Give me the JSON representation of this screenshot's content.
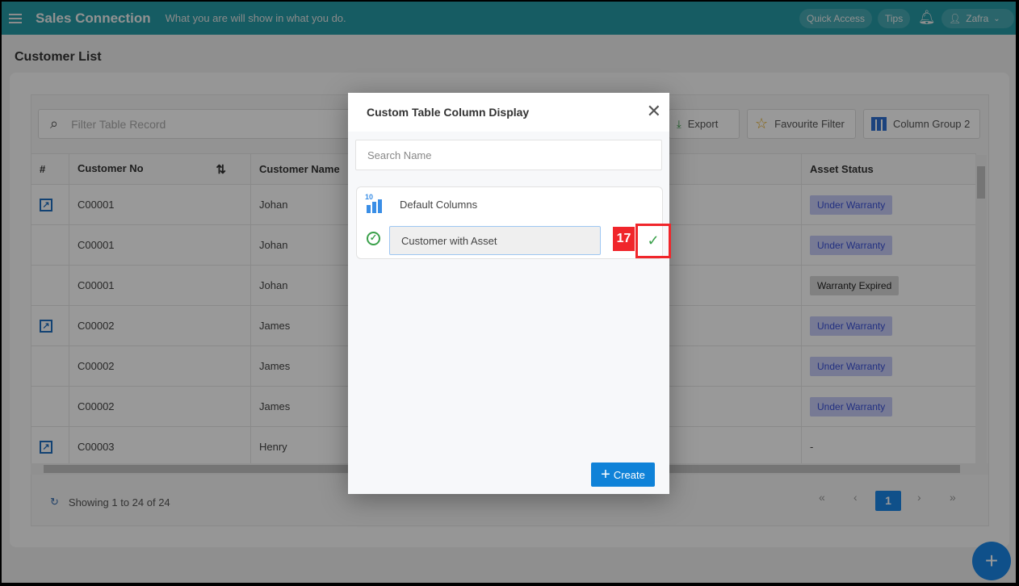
{
  "header": {
    "app_name": "Sales Connection",
    "tagline": "What you are will show in what you do.",
    "quick_access": "Quick Access",
    "tips": "Tips",
    "user": "Zafra"
  },
  "page": {
    "title": "Customer List"
  },
  "toolbar": {
    "filter_placeholder": "Filter Table Record",
    "export": "Export",
    "favourite_filter": "Favourite Filter",
    "column_group": "Column Group 2"
  },
  "table": {
    "columns": [
      "#",
      "Customer No",
      "Customer Name",
      "Asset Status"
    ],
    "rows": [
      {
        "edit": true,
        "no": "C00001",
        "name": "Johan",
        "status": "Under Warranty",
        "type": "uw"
      },
      {
        "edit": false,
        "no": "C00001",
        "name": "Johan",
        "status": "Under Warranty",
        "type": "uw"
      },
      {
        "edit": false,
        "no": "C00001",
        "name": "Johan",
        "status": "Warranty Expired",
        "type": "we"
      },
      {
        "edit": true,
        "no": "C00002",
        "name": "James",
        "status": "Under Warranty",
        "type": "uw"
      },
      {
        "edit": false,
        "no": "C00002",
        "name": "James",
        "status": "Under Warranty",
        "type": "uw"
      },
      {
        "edit": false,
        "no": "C00002",
        "name": "James",
        "status": "Under Warranty",
        "type": "uw"
      },
      {
        "edit": true,
        "no": "C00003",
        "name": "Henry",
        "status": "-",
        "type": "none"
      }
    ]
  },
  "footer": {
    "showing": "Showing 1 to 24 of 24",
    "current_page": "1",
    "first": "«",
    "prev": "‹",
    "next": "›",
    "last": "»"
  },
  "fab": "+",
  "modal": {
    "title": "Custom Table Column Display",
    "close": "✕",
    "search_placeholder": "Search Name",
    "items": [
      {
        "label": "Default Columns",
        "icon": "column-chart-icon"
      },
      {
        "value": "Customer with Asset",
        "icon": "check-circle-icon"
      }
    ],
    "annotation": "17",
    "confirm": "✓",
    "create": "Create",
    "create_icon": "+"
  },
  "colors": {
    "header": "#269aa5",
    "primary": "#0f82d8",
    "annotation": "#f0262b"
  }
}
